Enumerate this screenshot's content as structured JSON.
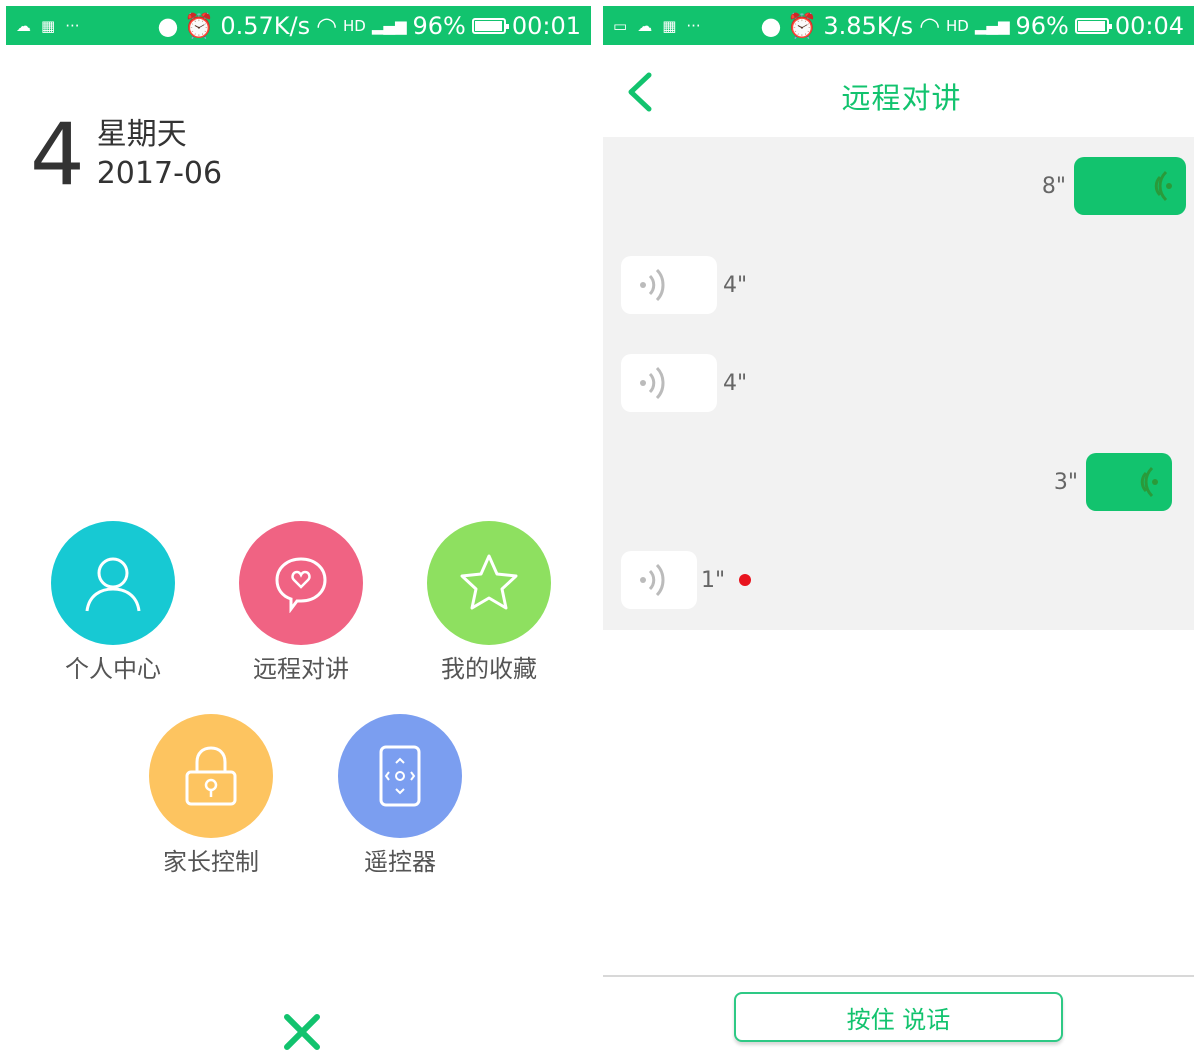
{
  "left_screen": {
    "status": {
      "speed": "0.57K/s",
      "battery_percent": "96%",
      "battery_level": 0.96,
      "time": "00:01",
      "network": "HD",
      "dots": "···"
    },
    "date": {
      "day": "4",
      "weekday": "星期天",
      "year_month": "2017-06"
    },
    "menu": [
      {
        "label": "个人中心",
        "color": "#17c9d3",
        "icon": "person-icon"
      },
      {
        "label": "远程对讲",
        "color": "#f06383",
        "icon": "chat-heart-icon"
      },
      {
        "label": "我的收藏",
        "color": "#8ee060",
        "icon": "star-icon"
      },
      {
        "label": "家长控制",
        "color": "#fdc460",
        "icon": "lock-icon"
      },
      {
        "label": "遥控器",
        "color": "#7b9ef0",
        "icon": "remote-control-icon"
      }
    ],
    "close_icon": "close-icon"
  },
  "right_screen": {
    "status": {
      "speed": "3.85K/s",
      "battery_percent": "96%",
      "battery_level": 0.96,
      "time": "00:04",
      "network": "HD",
      "dots": "···"
    },
    "title": "远程对讲",
    "messages": [
      {
        "direction": "outgoing",
        "duration": "8\""
      },
      {
        "direction": "incoming",
        "duration": "4\""
      },
      {
        "direction": "incoming",
        "duration": "4\""
      },
      {
        "direction": "outgoing",
        "duration": "3\""
      },
      {
        "direction": "incoming",
        "duration": "1\"",
        "unread": true
      }
    ],
    "hold_to_talk_label": "按住 说话"
  },
  "colors": {
    "accent": "#12c36e",
    "chat_bg": "#f2f2f2",
    "unread": "#e8141e"
  }
}
